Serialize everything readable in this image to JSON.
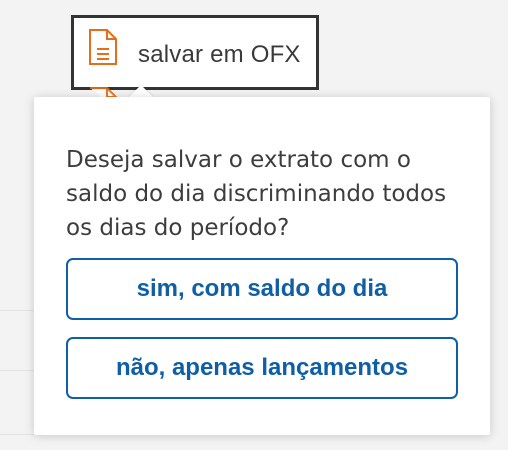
{
  "export_option": {
    "label": "salvar em OFX",
    "icon": "document-icon",
    "accent_color": "#e56e1b"
  },
  "dialog": {
    "question": "Deseja salvar o extrato com o saldo do dia discriminando todos os dias do período?",
    "buttons": {
      "with_daily_balance": "sim, com saldo do dia",
      "only_transactions": "não, apenas lançamentos"
    },
    "button_color": "#0f5fa6"
  }
}
